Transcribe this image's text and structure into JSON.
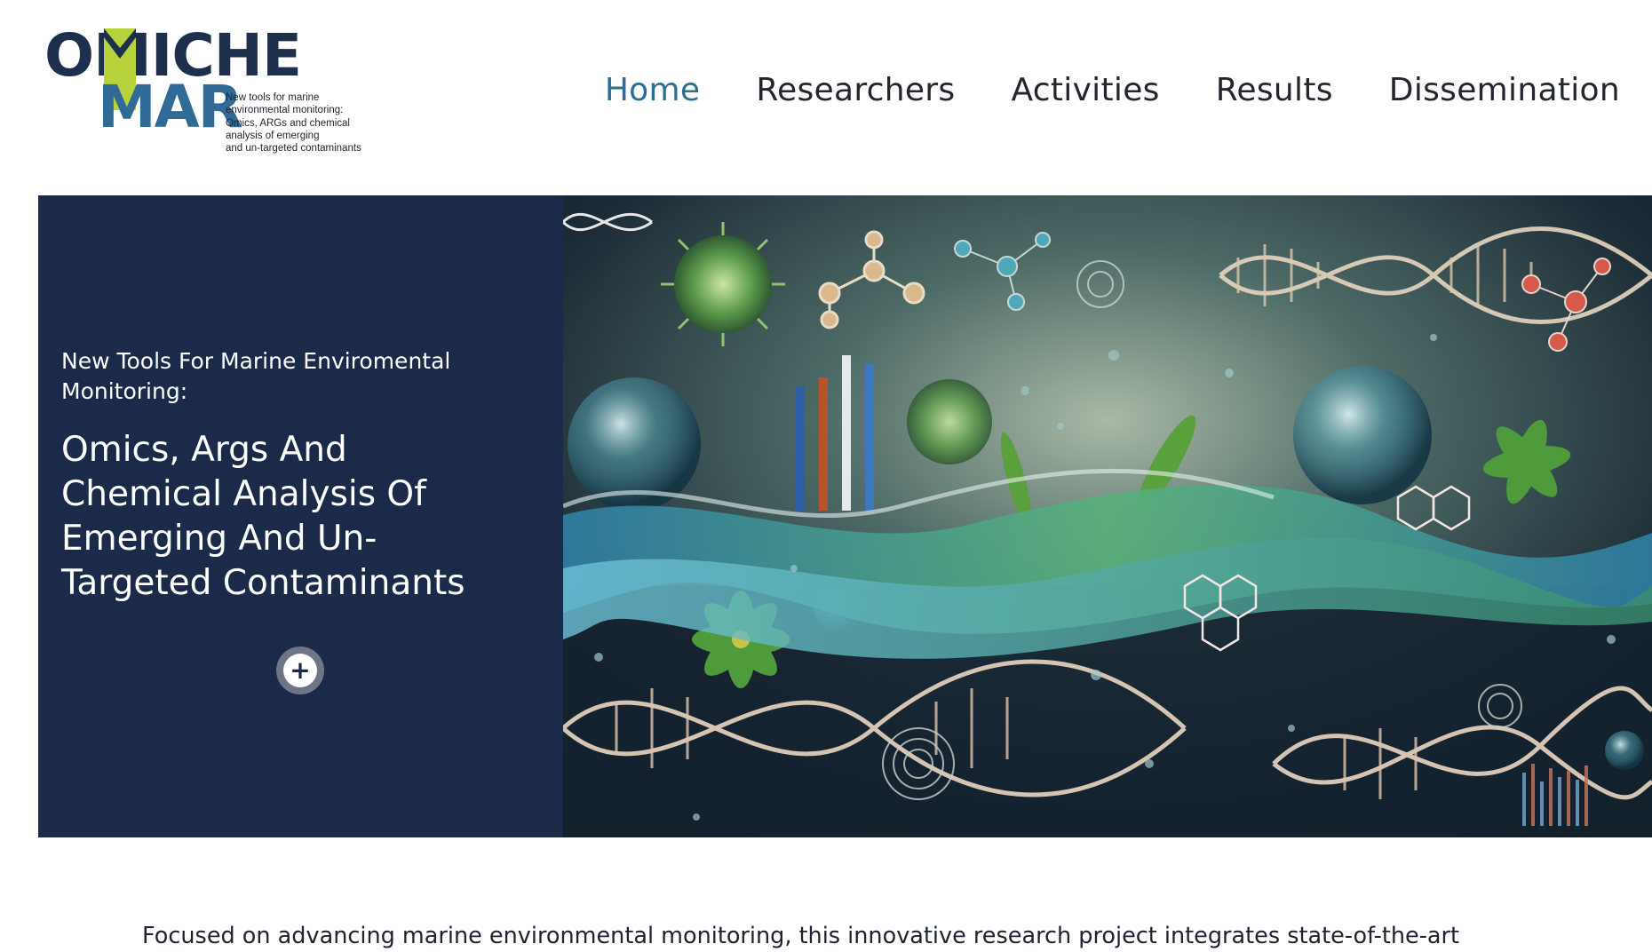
{
  "logo": {
    "brand_line1": "OMICHE",
    "brand_line2": "MAR",
    "tagline": "New tools for marine\nenvironmental monitoring:\nOmics, ARGs and chemical\nanalysis of emerging\nand un-targeted contaminants",
    "colors": {
      "navy": "#1e2f4d",
      "blue": "#2f6b96",
      "lime": "#b7d23a"
    }
  },
  "nav": {
    "items": [
      {
        "label": "Home",
        "active": true
      },
      {
        "label": "Researchers",
        "active": false
      },
      {
        "label": "Activities",
        "active": false
      },
      {
        "label": "Results",
        "active": false
      },
      {
        "label": "Dissemination",
        "active": false
      }
    ],
    "active_color": "#2b6f96"
  },
  "hero": {
    "subtitle": "New Tools For Marine Enviromental\nMonitoring:",
    "title": "Omics, Args And\nChemical Analysis Of\nEmerging And Un-\nTargeted Contaminants",
    "expand_icon": "plus-icon",
    "panel_color": "#1b2a48",
    "image_icon": "marine-omics-illustration"
  },
  "intro": {
    "text": "Focused on advancing marine environmental monitoring, this innovative research project integrates state-of-the-art"
  }
}
